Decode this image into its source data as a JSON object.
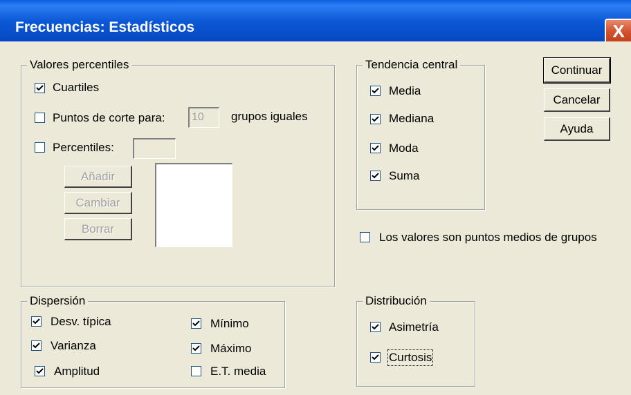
{
  "window": {
    "title": "Frecuencias: Estadísticos",
    "close_label": "X"
  },
  "percentiles": {
    "legend": "Valores percentiles",
    "cuartiles": {
      "label": "Cuartiles",
      "checked": true
    },
    "puntos_corte": {
      "label": "Puntos de corte para:",
      "checked": false,
      "value": "10",
      "suffix": "grupos iguales"
    },
    "percentiles": {
      "label": "Percentiles:",
      "checked": false,
      "value": ""
    },
    "buttons": {
      "add": "Añadir",
      "change": "Cambiar",
      "delete": "Borrar"
    }
  },
  "central": {
    "legend": "Tendencia central",
    "media": "Media",
    "mediana": "Mediana",
    "moda": "Moda",
    "suma": "Suma"
  },
  "buttons": {
    "continue": "Continuar",
    "cancel": "Cancelar",
    "help": "Ayuda"
  },
  "midpoints": {
    "label": "Los valores son puntos medios de grupos",
    "checked": false
  },
  "dispersion": {
    "legend": "Dispersión",
    "std": "Desv. típica",
    "variance": "Varianza",
    "range": "Amplitud",
    "min": "Mínimo",
    "max": "Máximo",
    "se_mean": "E.T. media"
  },
  "distribution": {
    "legend": "Distribución",
    "skewness": "Asimetría",
    "kurtosis": "Curtosis"
  }
}
